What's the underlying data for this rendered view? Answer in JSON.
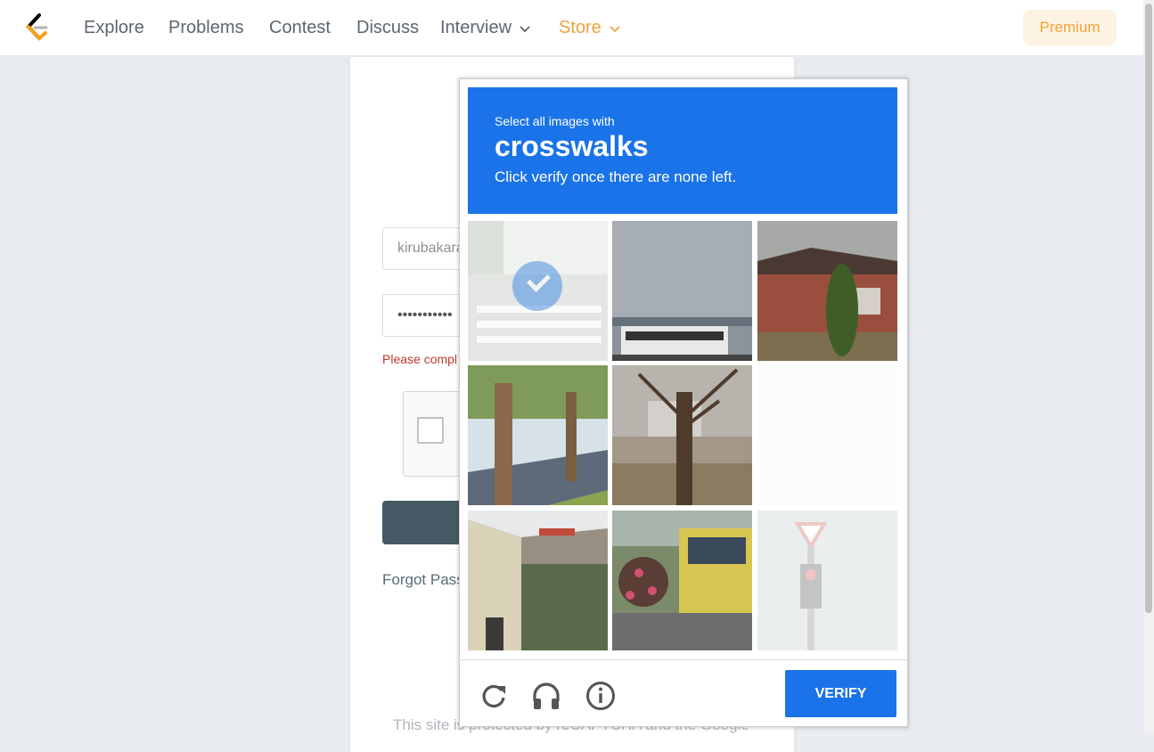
{
  "nav": {
    "items": [
      {
        "label": "Explore"
      },
      {
        "label": "Problems"
      },
      {
        "label": "Contest"
      },
      {
        "label": "Discuss"
      },
      {
        "label": "Interview"
      },
      {
        "label": "Store"
      }
    ],
    "premium_label": "Premium"
  },
  "login": {
    "username_value": "kirubakara",
    "password_value": "•••••••••••",
    "error_text": "Please compl",
    "forgot_label": "Forgot Pass",
    "protected_text": "This site is protected by reCAPTCHA and the Google"
  },
  "captcha": {
    "subtitle": "Select all images with",
    "target_word": "crosswalks",
    "instruction": "Click verify once there are none left.",
    "verify_label": "VERIFY",
    "tiles": [
      {
        "subject": "crosswalk",
        "state": "selected"
      },
      {
        "subject": "bus-sky",
        "state": "normal"
      },
      {
        "subject": "brick-house",
        "state": "normal"
      },
      {
        "subject": "street-trees",
        "state": "normal"
      },
      {
        "subject": "bare-tree",
        "state": "normal"
      },
      {
        "subject": "blank",
        "state": "loading"
      },
      {
        "subject": "building-stairs",
        "state": "normal"
      },
      {
        "subject": "bus-flowers",
        "state": "normal"
      },
      {
        "subject": "traffic-light",
        "state": "loading"
      }
    ],
    "footer_icons": [
      "reload-icon",
      "headphones-icon",
      "info-icon"
    ],
    "accent_color": "#1a73e8"
  }
}
